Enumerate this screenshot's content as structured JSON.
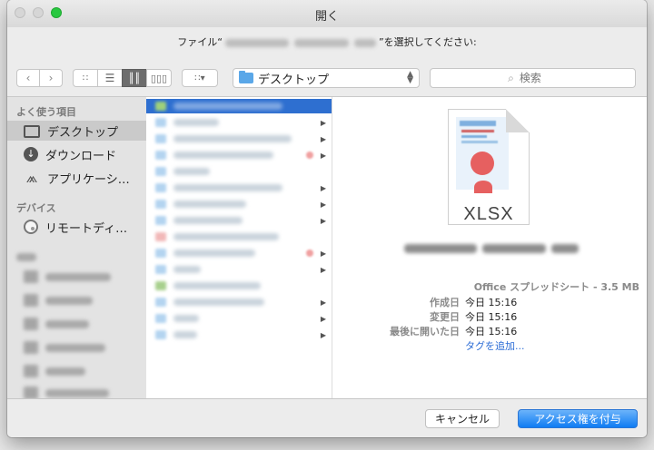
{
  "window": {
    "title": "開く"
  },
  "prompt": {
    "prefix": "ファイル“",
    "suffix": "”を選択してください:"
  },
  "toolbar": {
    "back_icon": "chevron-left-icon",
    "forward_icon": "chevron-right-icon",
    "view_modes": [
      "icon-view",
      "list-view",
      "column-view",
      "coverflow-view"
    ],
    "active_view": "column-view",
    "arrange_icon": "grid-arrange-icon",
    "location": "デスクトップ",
    "search_placeholder": "検索"
  },
  "sidebar": {
    "favorites_header": "よく使う項目",
    "favorites": [
      {
        "label": "デスクトップ",
        "icon": "desktop-icon",
        "selected": true
      },
      {
        "label": "ダウンロード",
        "icon": "download-icon",
        "selected": false
      },
      {
        "label": "アプリケーシ…",
        "icon": "applications-icon",
        "selected": false
      }
    ],
    "devices_header": "デバイス",
    "devices": [
      {
        "label": "リモートディ…",
        "icon": "remote-disc-icon"
      }
    ]
  },
  "preview": {
    "file_type_label": "XLSX",
    "kind": "Office スプレッドシート - 3.5 MB",
    "created_label": "作成日",
    "created_value": "今日 15:16",
    "modified_label": "変更日",
    "modified_value": "今日 15:16",
    "last_opened_label": "最後に開いた日",
    "last_opened_value": "今日 15:16",
    "add_tags": "タグを追加..."
  },
  "buttons": {
    "cancel": "キャンセル",
    "grant": "アクセス権を付与"
  },
  "colors": {
    "accent": "#0f7cf3",
    "selection": "#2e6fd0",
    "link": "#2c6dd6"
  }
}
